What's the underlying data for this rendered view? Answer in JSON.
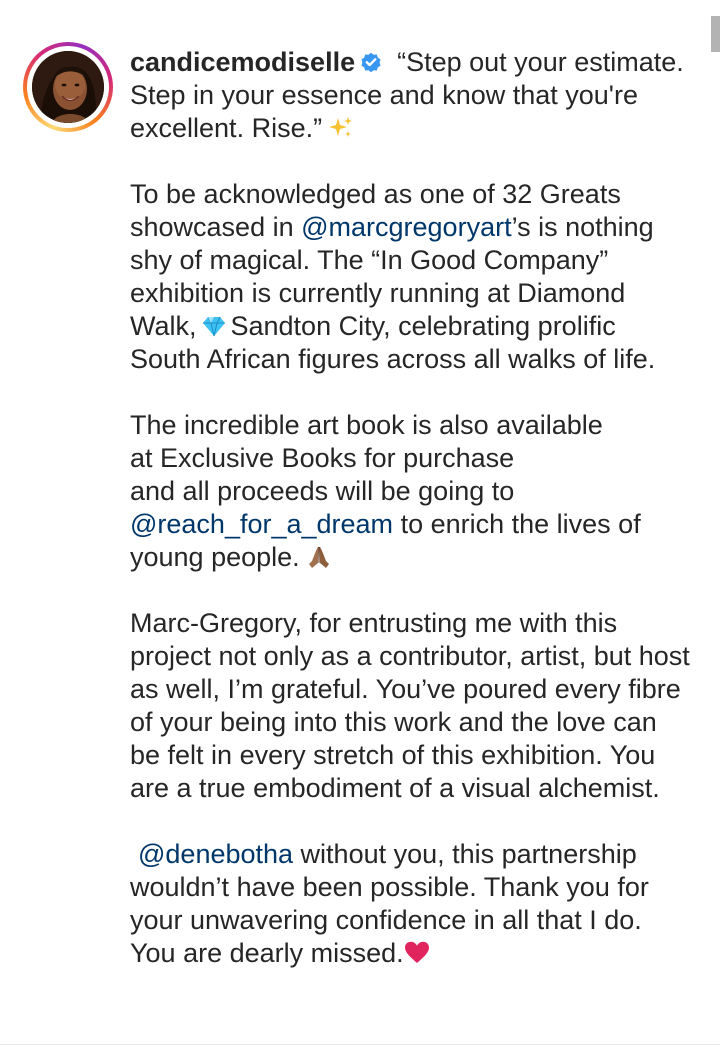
{
  "post": {
    "username": "candicemodiselle",
    "verified_icon": "verified-badge-icon",
    "quote": "“Step out your estimate. Step in your essence and know that you're excellent. Rise.”",
    "para2": {
      "text1": "To be acknowledged as one of 32 Greats showcased in ",
      "mention": "@marcgregoryart",
      "text2": "’s is nothing shy of magical. The “In Good Company” exhibition is currently running at Diamond Walk,",
      "text3": "Sandton City, celebrating prolific South African figures across all walks of life."
    },
    "para3": {
      "line1": "The incredible art book is also available",
      "line2": "at Exclusive Books for purchase",
      "line3": "and all proceeds will be going to",
      "mention": "@reach_for_a_dream",
      "text2": " to enrich the lives of young people."
    },
    "para4": "Marc-Gregory, for entrusting me with this project not only as a contributor, artist, but host as well, I’m grateful. You’ve poured every fibre of your being into this work and the love can be felt in every stretch of this exhibition. You are a true embodiment of a visual alchemist.",
    "para5": {
      "mention": "@denebotha",
      "text": " without you, this partnership wouldn’t have been possible. Thank you for your unwavering confidence in all that I do. You are dearly missed."
    }
  },
  "icons": [
    "verified-badge-icon",
    "sparkles-emoji",
    "gem-emoji",
    "folded-hands-emoji",
    "red-heart-emoji"
  ],
  "colors": {
    "text": "#262626",
    "mention": "#00376b",
    "verified": "#3897f0",
    "heart": "#e0245e",
    "gem": "#3ec1f3"
  }
}
